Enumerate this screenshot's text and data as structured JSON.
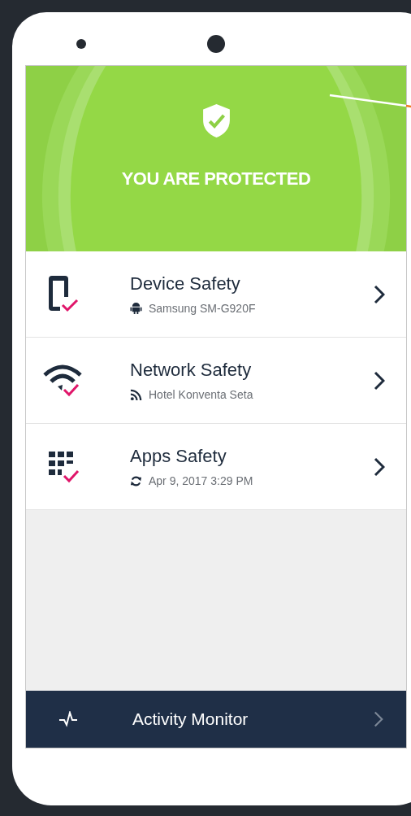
{
  "header": {
    "status": "YOU ARE PROTECTED"
  },
  "items": [
    {
      "kind": "device",
      "title": "Device Safety",
      "detail": "Samsung SM-G920F"
    },
    {
      "kind": "network",
      "title": "Network Safety",
      "detail": "Hotel Konventa Seta"
    },
    {
      "kind": "apps",
      "title": "Apps Safety",
      "detail": "Apr 9, 2017 3:29 PM"
    }
  ],
  "footer": {
    "label": "Activity Monitor"
  }
}
